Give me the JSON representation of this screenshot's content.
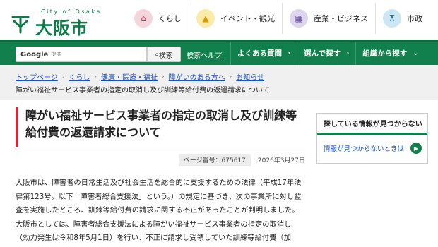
{
  "header": {
    "logo_city": "City of Osaka",
    "logo_name": "大阪市",
    "topnav": [
      {
        "label": "くらし",
        "icon": "house-icon"
      },
      {
        "label": "イベント・観光",
        "icon": "event-icon"
      },
      {
        "label": "産業・ビジネス",
        "icon": "building-icon"
      },
      {
        "label": "市政",
        "icon": "city-hall-icon"
      }
    ]
  },
  "search": {
    "brand": "Google",
    "brand_sub": "提供",
    "button_label": "検索",
    "help_link": "検索ヘルプ"
  },
  "gnav": {
    "items": [
      {
        "label": "よくある質問"
      },
      {
        "label": "選んで探す"
      },
      {
        "label": "組織から探す"
      }
    ]
  },
  "breadcrumb": {
    "items": [
      "トップページ",
      "くらし",
      "健康・医療・福祉",
      "障がいのある方へ",
      "お知らせ"
    ],
    "current": "障がい福祉サービス事業者の指定の取消し及び訓練等給付費の返還請求について"
  },
  "article": {
    "title": "障がい福祉サービス事業者の指定の取消し及び訓練等給付費の返還請求について",
    "page_no": "ページ番号：675617",
    "date": "2026年3月27日",
    "para1": "大阪市は、障害者の日常生活及び社会生活を総合的に支援するための法律（平成17年法律第123号。以下「障害者総合支援法」という。）の規定に基づき、次の事業所に対し監査を実施したところ、訓練等給付費の請求に関する不正があったことが判明しました。",
    "para2": "大阪市としては、障害者総合支援法による障がい福祉サービス事業者の指定の取消し（効力発生は令和8年5月1日）を行い、不正に請求し受領していた訓練等給付費（加"
  },
  "side": {
    "heading": "探している情報が見つからない",
    "link": "情報が見つからないときは"
  },
  "colors": {
    "brand_green": "#11804d",
    "title_accent": "#d6263a",
    "link_blue": "#1a55c4"
  }
}
